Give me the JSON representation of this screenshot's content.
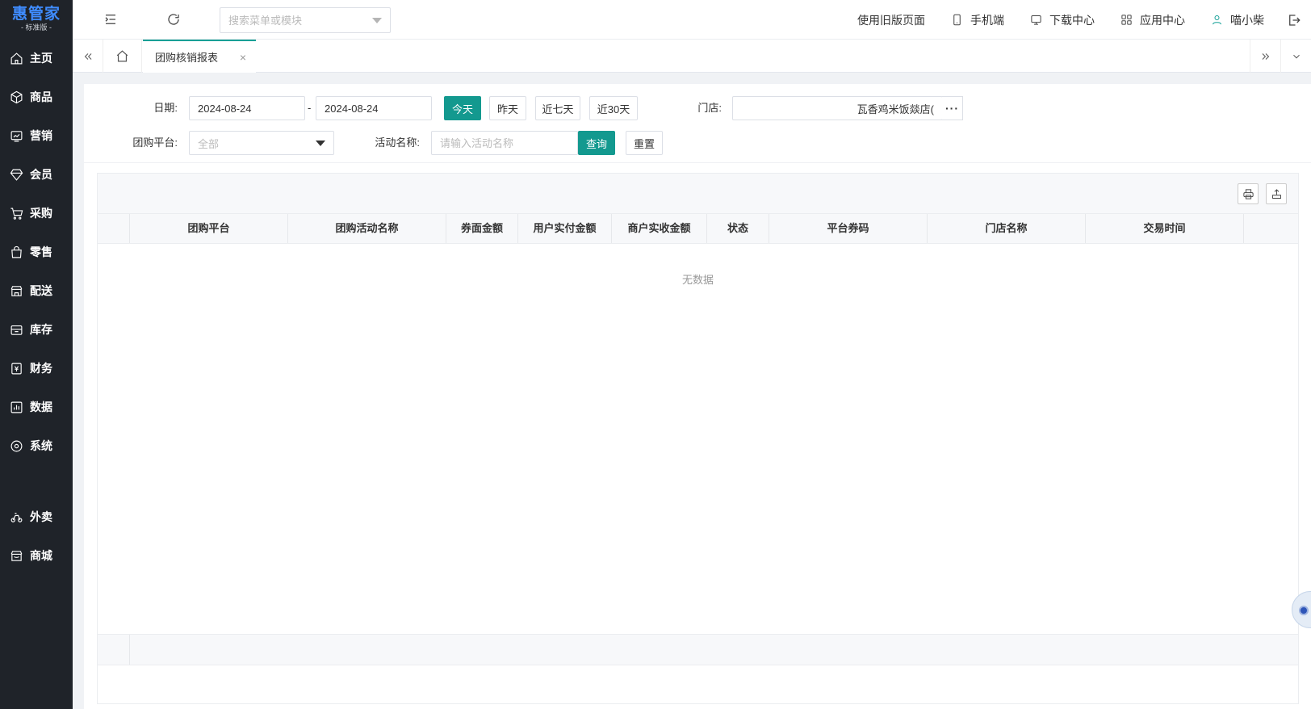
{
  "sidebar": {
    "logo": {
      "main": "惠管家",
      "sub": "- 标准版 -"
    },
    "items": [
      {
        "label": "主页",
        "icon": "home-icon"
      },
      {
        "label": "商品",
        "icon": "cube-icon"
      },
      {
        "label": "营销",
        "icon": "chart-card-icon"
      },
      {
        "label": "会员",
        "icon": "diamond-icon"
      },
      {
        "label": "采购",
        "icon": "cart-icon"
      },
      {
        "label": "零售",
        "icon": "bag-icon"
      },
      {
        "label": "配送",
        "icon": "store-icon"
      },
      {
        "label": "库存",
        "icon": "inbox-icon"
      },
      {
        "label": "财务",
        "icon": "finance-icon"
      },
      {
        "label": "数据",
        "icon": "bar-chart-icon"
      },
      {
        "label": "系统",
        "icon": "settings-icon"
      }
    ],
    "extra_items": [
      {
        "label": "外卖",
        "icon": "bike-icon"
      },
      {
        "label": "商城",
        "icon": "shop-icon"
      }
    ]
  },
  "topbar": {
    "search_placeholder": "搜索菜单或模块",
    "links": {
      "old_version": "使用旧版页面",
      "mobile": "手机端",
      "download": "下载中心",
      "apps": "应用中心",
      "user": "喵小柴"
    }
  },
  "tabs": {
    "active": "团购核销报表",
    "close": "×"
  },
  "filters": {
    "date_label": "日期:",
    "date_start": "2024-08-24",
    "date_end": "2024-08-24",
    "range_sep": "-",
    "quick": {
      "today": "今天",
      "yesterday": "昨天",
      "last7": "近七天",
      "last30": "近30天"
    },
    "store_label": "门店:",
    "store_value": "瓦香鸡米饭燚店(",
    "more": "···",
    "platform_label": "团购平台:",
    "platform_value": "全部",
    "activity_label": "活动名称:",
    "activity_placeholder": "请输入活动名称",
    "query": "查询",
    "reset": "重置"
  },
  "table": {
    "columns": [
      "团购平台",
      "团购活动名称",
      "券面金额",
      "用户实付金额",
      "商户实收金额",
      "状态",
      "平台券码",
      "门店名称",
      "交易时间"
    ],
    "empty_text": "无数据"
  },
  "colors": {
    "sidebar_bg": "#1f2329",
    "accent": "#13998f",
    "logo": "#3f8cff"
  }
}
